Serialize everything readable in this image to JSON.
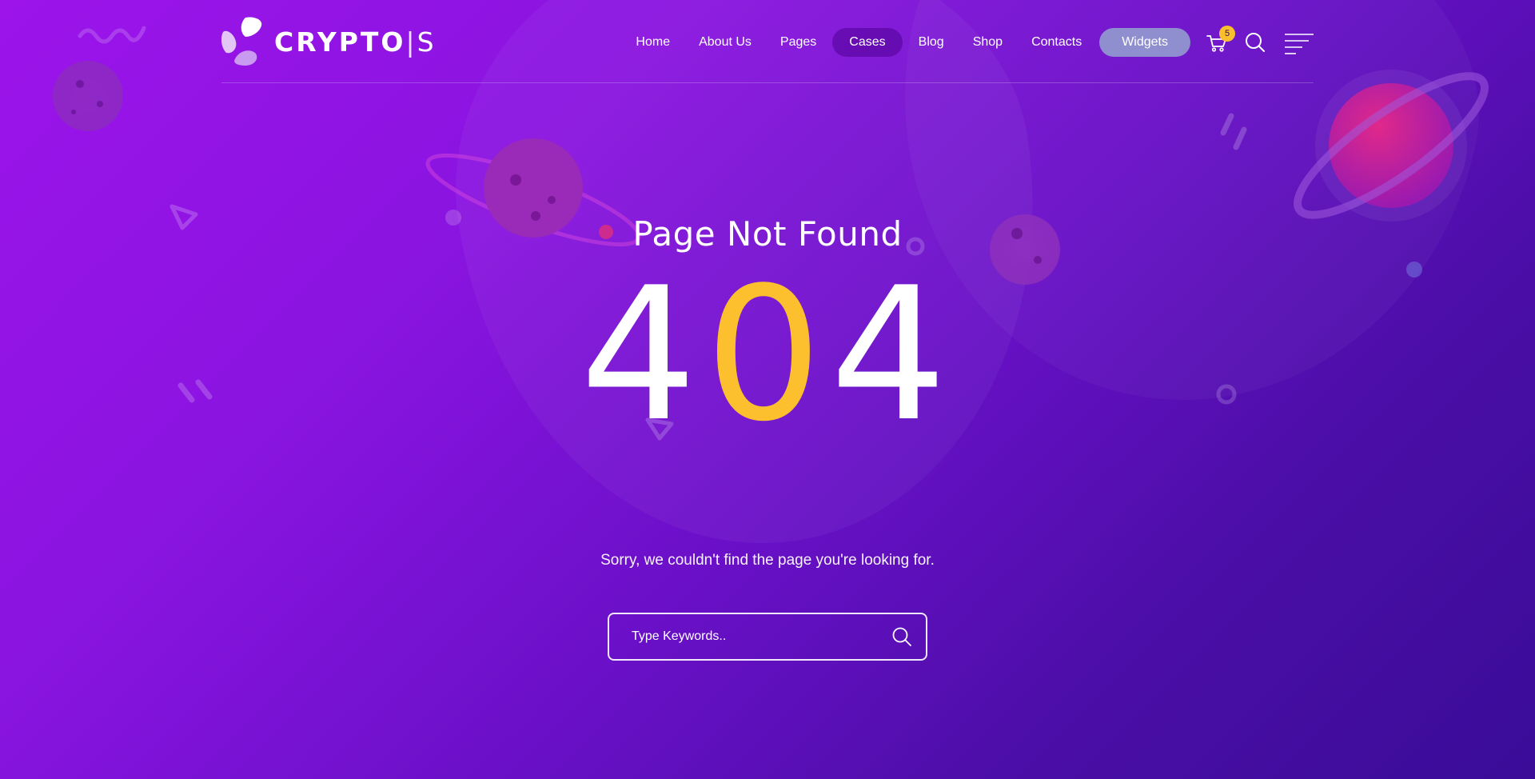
{
  "brand": {
    "name": "CRYPTO",
    "suffix": "S",
    "divider": "|"
  },
  "nav": {
    "items": [
      {
        "label": "Home"
      },
      {
        "label": "About Us"
      },
      {
        "label": "Pages"
      },
      {
        "label": "Cases",
        "active": true
      },
      {
        "label": "Blog"
      },
      {
        "label": "Shop"
      },
      {
        "label": "Contacts"
      }
    ],
    "cta_label": "Widgets",
    "cart_count": "5",
    "icons": [
      "cart-icon",
      "search-icon",
      "menu-icon"
    ]
  },
  "main": {
    "title": "Page Not Found",
    "code_left": "4",
    "code_mid": "0",
    "code_right": "4",
    "message": "Sorry, we couldn't find the page you're looking for."
  },
  "search": {
    "placeholder": "Type Keywords..",
    "value": ""
  },
  "colors": {
    "accent": "#fcc02f",
    "bg_start": "#9c14ea",
    "bg_end": "#3a0c98",
    "widgets_button": "#8f8fd0"
  }
}
